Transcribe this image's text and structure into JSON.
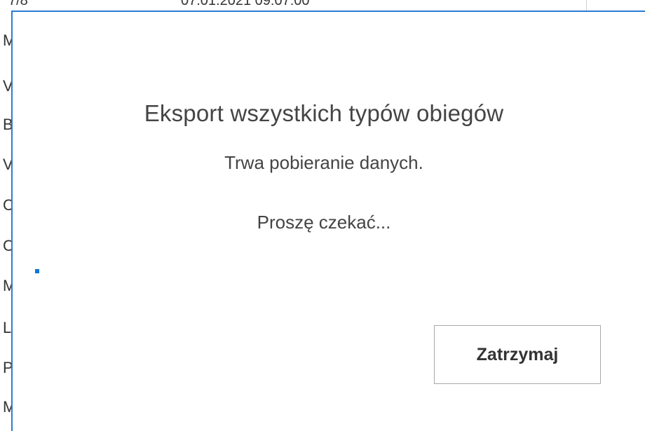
{
  "background": {
    "top_row": [
      "7/8",
      "07.01.2021 09:07:00"
    ],
    "list_initials": [
      "M",
      "V",
      "B",
      "V",
      "C",
      "C",
      "M",
      "L",
      "P",
      "M"
    ]
  },
  "dialog": {
    "title": "Eksport wszystkich typów obiegów",
    "status": "Trwa pobieranie danych.",
    "wait_message": "Proszę czekać...",
    "stop_button_label": "Zatrzymaj",
    "accent_color": "#0a74d6"
  }
}
